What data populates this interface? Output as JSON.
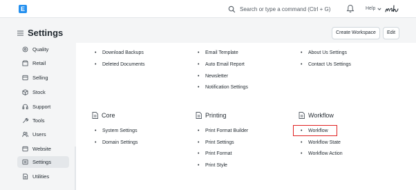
{
  "navbar": {
    "logo_letter": "E",
    "search_placeholder": "Search or type a command (Ctrl + G)",
    "help_label": "Help",
    "avatar_label": "nch"
  },
  "header": {
    "title": "Settings",
    "create_workspace": "Create Workspace",
    "edit": "Edit"
  },
  "sidebar": {
    "items": [
      {
        "label": "Quality",
        "icon": "quality-icon"
      },
      {
        "label": "Retail",
        "icon": "retail-icon"
      },
      {
        "label": "Selling",
        "icon": "selling-icon"
      },
      {
        "label": "Stock",
        "icon": "stock-icon"
      },
      {
        "label": "Support",
        "icon": "support-icon"
      },
      {
        "label": "Tools",
        "icon": "tools-icon"
      },
      {
        "label": "Users",
        "icon": "users-icon"
      },
      {
        "label": "Website",
        "icon": "website-icon"
      },
      {
        "label": "Settings",
        "icon": "settings-icon",
        "active": true
      },
      {
        "label": "Utilities",
        "icon": "utilities-icon"
      }
    ]
  },
  "top_links": {
    "col1": [
      "Download Backups",
      "Deleted Documents"
    ],
    "col2": [
      "Email Template",
      "Auto Email Report",
      "Newsletter",
      "Notification Settings"
    ],
    "col3": [
      "About Us Settings",
      "Contact Us Settings"
    ]
  },
  "sections": [
    {
      "title": "Core",
      "links": [
        "System Settings",
        "Domain Settings"
      ]
    },
    {
      "title": "Printing",
      "links": [
        "Print Format Builder",
        "Print Settings",
        "Print Format",
        "Print Style"
      ]
    },
    {
      "title": "Workflow",
      "links": [
        "Workflow",
        "Workflow State",
        "Workflow Action"
      ]
    }
  ],
  "colors": {
    "accent": "#2490ef",
    "highlight_border": "#e02020"
  }
}
